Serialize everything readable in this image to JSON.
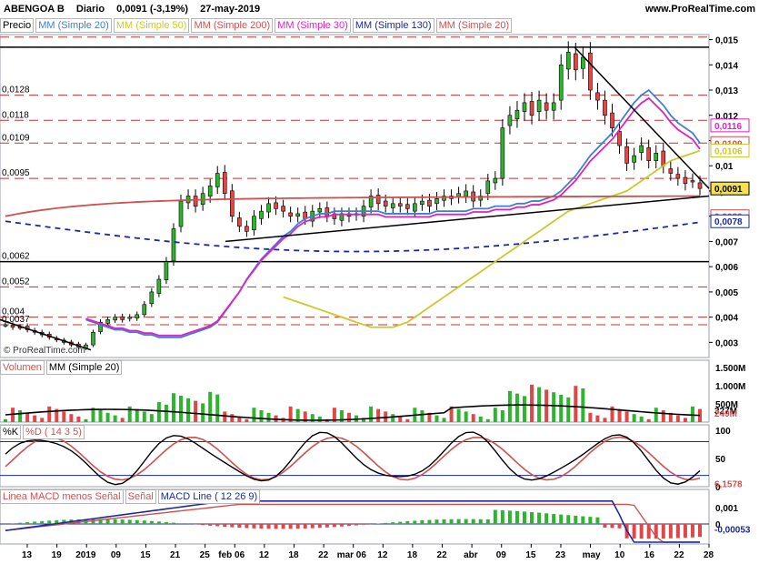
{
  "header": {
    "instrument": "ABENGOA B",
    "period": "Diario",
    "last": "0,0091 (-3,19%)",
    "date": "27-may-2019",
    "site": "www.ProRealTime.com"
  },
  "watermark": "© ProRealTime.com",
  "colors": {
    "up": "#2db62d",
    "down": "#e04848",
    "sma20": "#3b7fd8",
    "sma50": "#c9c92a",
    "sma200": "#d05050",
    "sma30": "#e020c0",
    "sma130": "#1a2aa0",
    "pink_fill": "#f2b6b6",
    "blue_fill": "#b9c6f2",
    "green_fill": "#c4ecb4"
  },
  "price_panel": {
    "label": "Precio",
    "indicators": [
      {
        "text": "MM (Simple 20)",
        "color": "#3b7fd8"
      },
      {
        "text": "MM (Simple 50)",
        "color": "#c9c92a"
      },
      {
        "text": "MM (Simple 200)",
        "color": "#d05050"
      },
      {
        "text": "MM (Simple 30)",
        "color": "#e020c0"
      },
      {
        "text": "MM (Simple 130)",
        "color": "#1a2aa0"
      },
      {
        "text": "MM (Simple 20)",
        "color": "#d05050"
      }
    ],
    "y_ticks": [
      "0,015",
      "0,014",
      "0,013",
      "0,012",
      "0,011",
      "0,01",
      "0,009",
      "0,008",
      "0,007",
      "0,006",
      "0,005",
      "0,004",
      "0,003"
    ],
    "left_levels": [
      "0,0128",
      "0,0118",
      "0,0109",
      "0,0095",
      "0,0062",
      "0,0052",
      "0,004",
      "0,0037"
    ],
    "right_badges": [
      {
        "text": "0,0116",
        "color": "#e020c0"
      },
      {
        "text": "0,0109",
        "color": "#d05050"
      },
      {
        "text": "0,0106",
        "color": "#c9c92a"
      },
      {
        "text": "0,0091",
        "color": "#000000"
      },
      {
        "text": "0,0080",
        "color": "#d05050"
      },
      {
        "text": "0,0078",
        "color": "#1a2aa0"
      }
    ]
  },
  "volume_panel": {
    "label": "Volumen",
    "indicator": "MM (Simple 20)",
    "y_ticks": [
      "1.500M",
      "1.000M",
      "500M"
    ],
    "right_badges": [
      "327M",
      "249M"
    ]
  },
  "stoch_panel": {
    "label": "%K",
    "indicator": "%D ( 14 3 5)",
    "y_ticks": [
      "100",
      "50",
      "0"
    ],
    "right_badges": [
      "6,1578"
    ]
  },
  "macd_panel": {
    "label": "Linea MACD menos Señal",
    "indicator_a": "Señal",
    "indicator_b": "MACD Line ( 12 26 9)",
    "y_ticks": [
      "0,001",
      "0"
    ],
    "right_badges": [
      "-0,00053"
    ]
  },
  "x_axis": [
    "13",
    "19",
    "2019",
    "09",
    "15",
    "21",
    "25",
    "feb 06",
    "12",
    "18",
    "22",
    "mar 06",
    "12",
    "18",
    "22",
    "abr",
    "09",
    "15",
    "23",
    "may",
    "10",
    "16",
    "22",
    "28"
  ],
  "chart_data": {
    "type": "candlestick",
    "x_labels": [
      "13",
      "19",
      "2019",
      "09",
      "15",
      "21",
      "25",
      "feb 06",
      "12",
      "18",
      "22",
      "mar 06",
      "12",
      "18",
      "22",
      "abr",
      "09",
      "15",
      "23",
      "may",
      "10",
      "16",
      "22",
      "28"
    ],
    "close": [
      0.0037,
      0.0036,
      0.0036,
      0.0035,
      0.0034,
      0.0033,
      0.0032,
      0.0031,
      0.003,
      0.0029,
      0.0028,
      0.0029,
      0.0034,
      0.0038,
      0.0039,
      0.004,
      0.0039,
      0.004,
      0.0041,
      0.0045,
      0.005,
      0.0055,
      0.0062,
      0.0075,
      0.0086,
      0.0088,
      0.0084,
      0.0089,
      0.0092,
      0.0097,
      0.0089,
      0.008,
      0.0076,
      0.0074,
      0.008,
      0.0082,
      0.0085,
      0.0083,
      0.0082,
      0.008,
      0.0081,
      0.0079,
      0.0082,
      0.0083,
      0.008,
      0.0079,
      0.0081,
      0.008,
      0.0081,
      0.0084,
      0.0088,
      0.0085,
      0.0084,
      0.0085,
      0.0084,
      0.0083,
      0.0085,
      0.0086,
      0.0084,
      0.0087,
      0.0088,
      0.0087,
      0.0089,
      0.009,
      0.0086,
      0.0088,
      0.0094,
      0.0095,
      0.0115,
      0.012,
      0.0122,
      0.0125,
      0.012,
      0.0126,
      0.0122,
      0.0125,
      0.014,
      0.0145,
      0.0138,
      0.0143,
      0.013,
      0.0126,
      0.012,
      0.0115,
      0.0108,
      0.0101,
      0.0104,
      0.0108,
      0.0102,
      0.0105,
      0.01,
      0.0097,
      0.0095,
      0.0093,
      0.0094,
      0.0091
    ],
    "sma20": [
      0.0039,
      0.0038,
      0.0037,
      0.0036,
      0.0035,
      0.0035,
      0.0034,
      0.0034,
      0.0033,
      0.0033,
      0.0032,
      0.0032,
      0.0032,
      0.0032,
      0.0033,
      0.0034,
      0.0035,
      0.0036,
      0.0038,
      0.0042,
      0.0046,
      0.005,
      0.0055,
      0.0059,
      0.0063,
      0.0066,
      0.0069,
      0.0072,
      0.0074,
      0.0077,
      0.0079,
      0.008,
      0.0081,
      0.0081,
      0.0082,
      0.0082,
      0.0082,
      0.0082,
      0.0082,
      0.0082,
      0.0082,
      0.0081,
      0.0081,
      0.0081,
      0.0081,
      0.0081,
      0.0081,
      0.0081,
      0.0082,
      0.0082,
      0.0082,
      0.0082,
      0.0082,
      0.0083,
      0.0083,
      0.0083,
      0.0084,
      0.0084,
      0.0084,
      0.0085,
      0.0085,
      0.0086,
      0.0086,
      0.0087,
      0.0088,
      0.009,
      0.0093,
      0.0096,
      0.01,
      0.0104,
      0.0107,
      0.011,
      0.0113,
      0.0117,
      0.0121,
      0.0125,
      0.0128,
      0.013,
      0.0127,
      0.0124,
      0.012,
      0.0117,
      0.0115,
      0.0113,
      0.0109
    ],
    "sma50": [
      0.0048,
      0.0047,
      0.0046,
      0.0045,
      0.0044,
      0.0043,
      0.0042,
      0.0041,
      0.004,
      0.0039,
      0.0038,
      0.0037,
      0.0036,
      0.0036,
      0.0036,
      0.0036,
      0.0037,
      0.0038,
      0.004,
      0.0042,
      0.0044,
      0.0046,
      0.0048,
      0.005,
      0.0052,
      0.0054,
      0.0056,
      0.0058,
      0.006,
      0.0062,
      0.0064,
      0.0066,
      0.0068,
      0.007,
      0.0072,
      0.0074,
      0.0076,
      0.0078,
      0.008,
      0.0082,
      0.0083,
      0.0084,
      0.0085,
      0.0086,
      0.0087,
      0.0088,
      0.0089,
      0.009,
      0.0092,
      0.0094,
      0.0096,
      0.0098,
      0.01,
      0.0102,
      0.0103,
      0.0104,
      0.0105,
      0.0106
    ]
  }
}
